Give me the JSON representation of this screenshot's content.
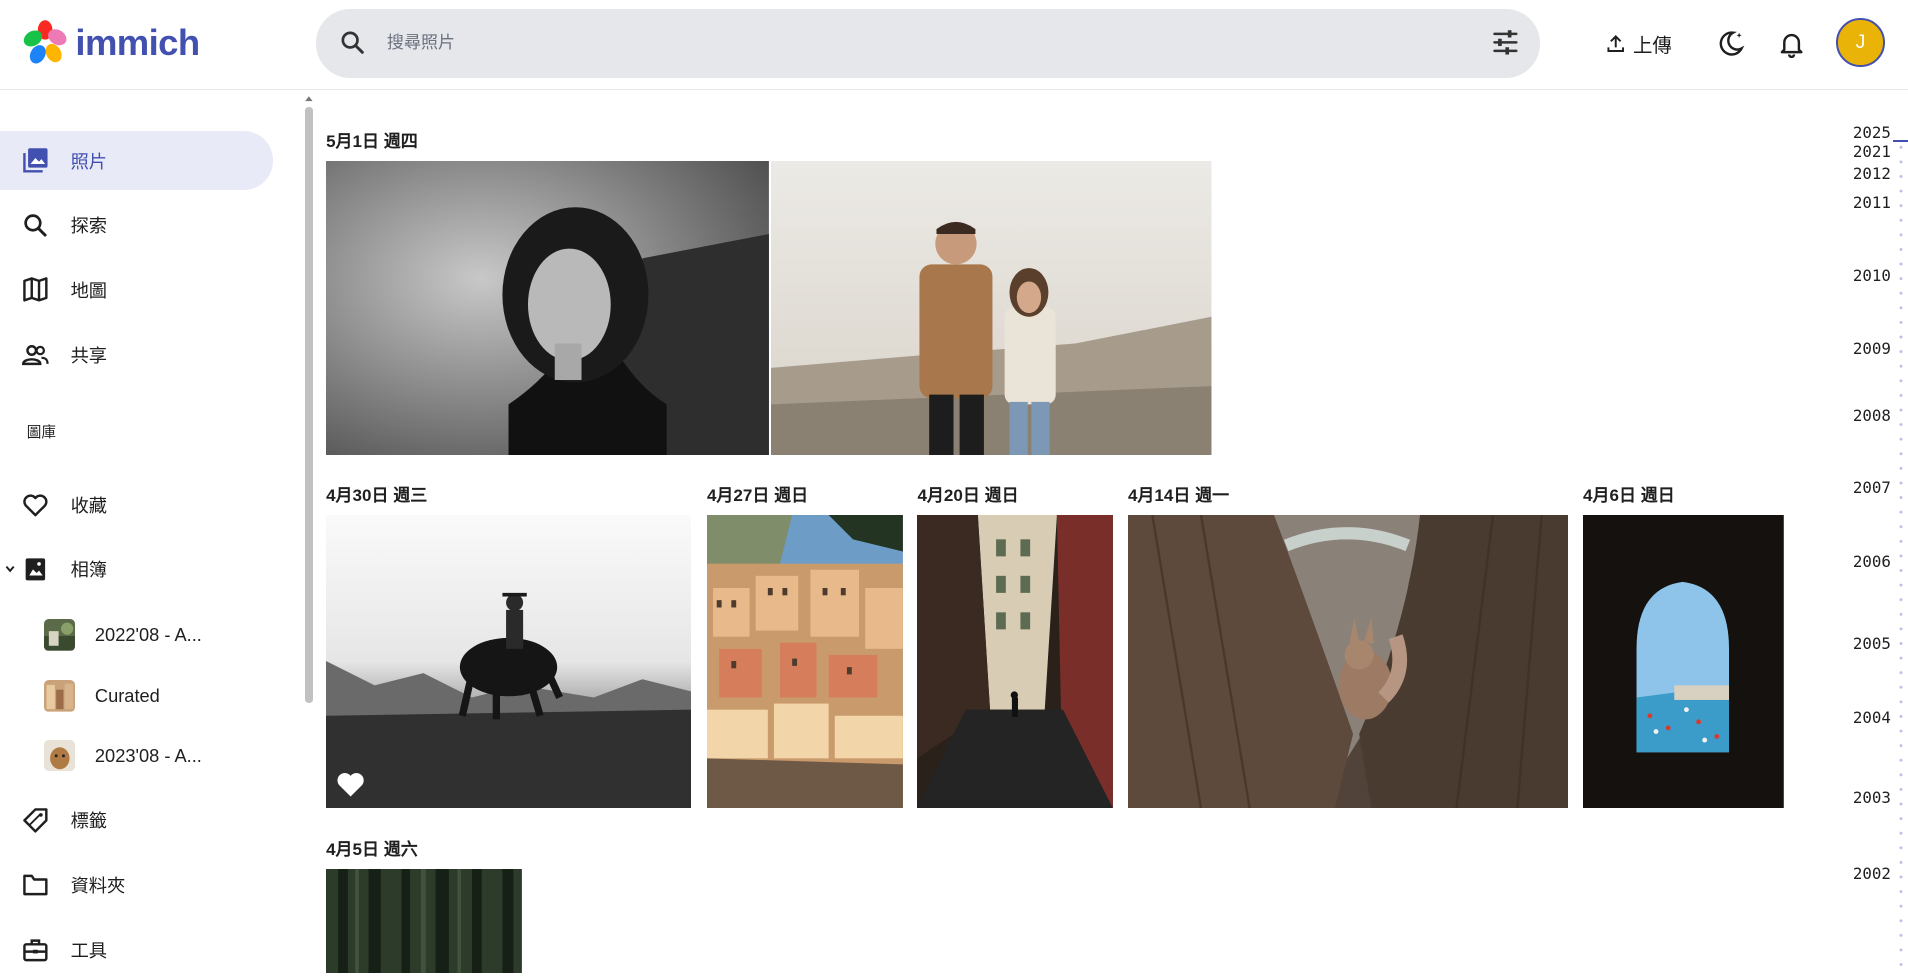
{
  "app": {
    "name": "immich"
  },
  "search": {
    "placeholder": "搜尋照片"
  },
  "header": {
    "upload_label": "上傳",
    "avatar_initial": "J"
  },
  "sidebar": {
    "items": [
      {
        "label": "照片",
        "icon": "photos-icon"
      },
      {
        "label": "探索",
        "icon": "search-icon"
      },
      {
        "label": "地圖",
        "icon": "map-icon"
      },
      {
        "label": "共享",
        "icon": "people-icon"
      }
    ],
    "library_title": "圖庫",
    "library_items": [
      {
        "label": "收藏",
        "icon": "heart-icon"
      },
      {
        "label": "相簿",
        "icon": "album-icon"
      }
    ],
    "albums": [
      {
        "label": "2022'08 - A..."
      },
      {
        "label": "Curated"
      },
      {
        "label": "2023'08 - A..."
      }
    ],
    "bottom_items": [
      {
        "label": "標籤",
        "icon": "tag-icon"
      },
      {
        "label": "資料夾",
        "icon": "folder-icon"
      },
      {
        "label": "工具",
        "icon": "toolbox-icon"
      }
    ]
  },
  "timeline": {
    "groups": [
      {
        "date": "5月1日 週四"
      },
      {
        "date": "4月30日 週三"
      },
      {
        "date": "4月27日 週日"
      },
      {
        "date": "4月20日 週日"
      },
      {
        "date": "4月14日 週一"
      },
      {
        "date": "4月6日 週日"
      },
      {
        "date": "4月5日 週六"
      }
    ]
  },
  "years": [
    "2025",
    "2021",
    "2012",
    "2011",
    "2010",
    "2009",
    "2008",
    "2007",
    "2006",
    "2005",
    "2004",
    "2003",
    "2002"
  ],
  "colors": {
    "accent": "#4250af",
    "active_bg": "#e8eaf7",
    "avatar": "#eab308"
  }
}
